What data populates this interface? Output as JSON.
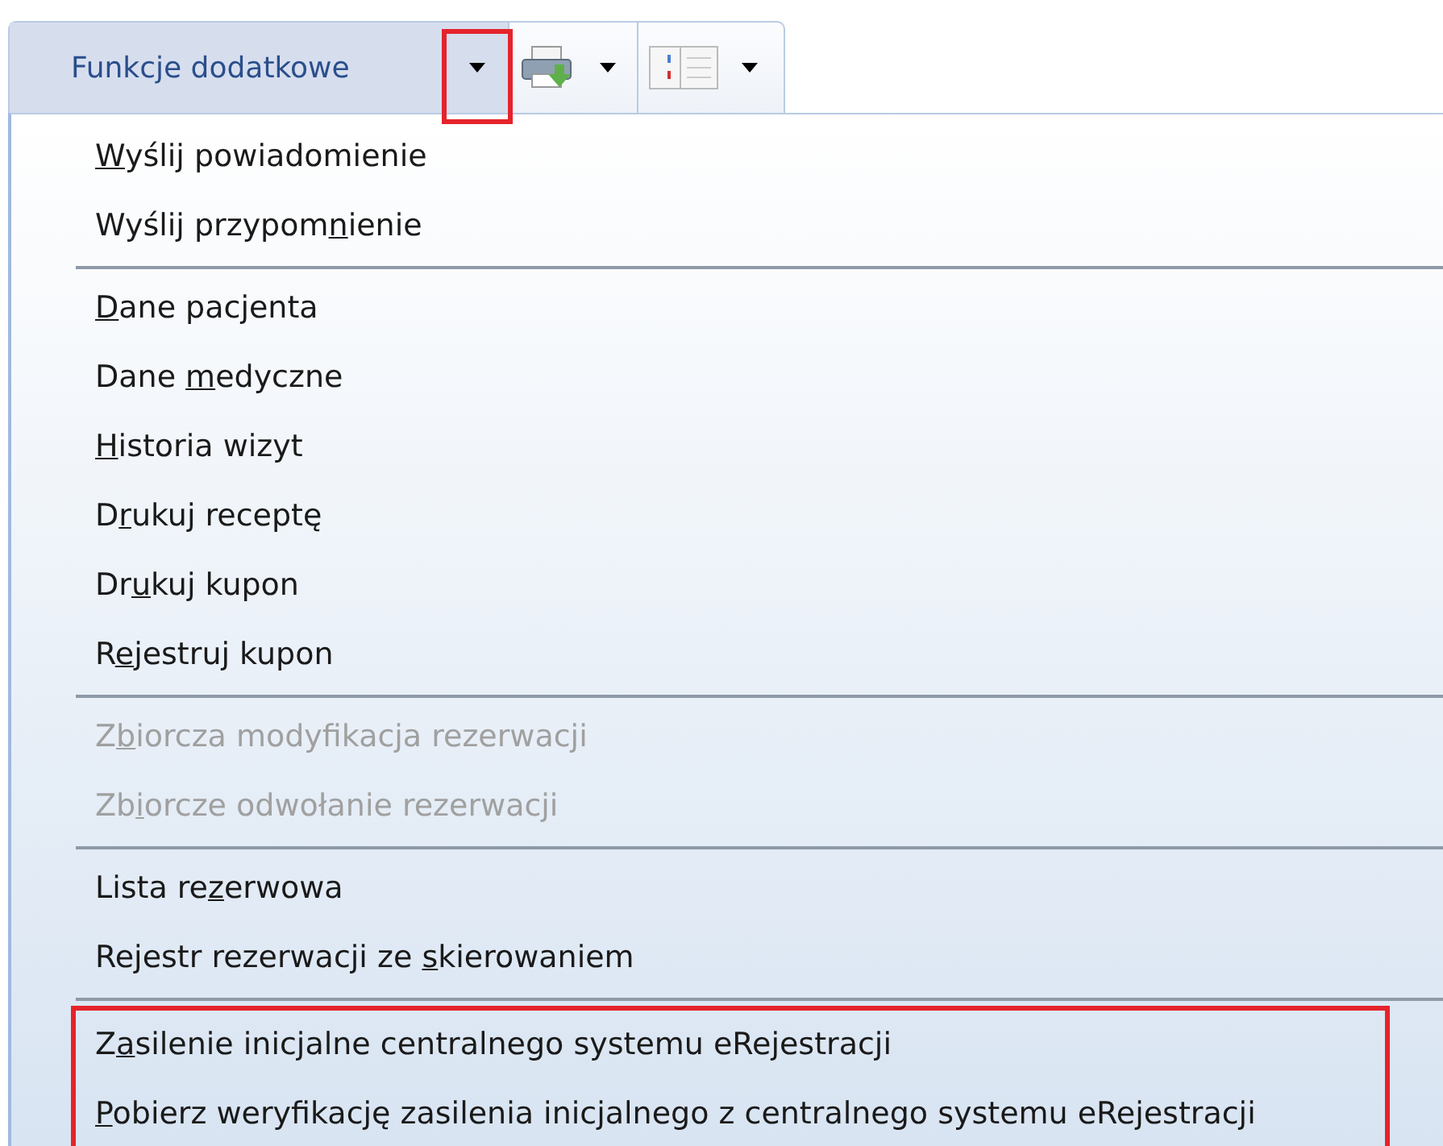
{
  "toolbar": {
    "buttons": [
      {
        "kind": "text",
        "label": "Funkcje dodatkowe",
        "selected": true,
        "annotated": true
      },
      {
        "kind": "printer",
        "selected": false,
        "annotated": false
      },
      {
        "kind": "columns",
        "selected": false,
        "annotated": false
      }
    ]
  },
  "menu": {
    "entries": [
      {
        "kind": "item",
        "key": "W",
        "after": "yślij powiadomienie",
        "disabled": false,
        "annotated": false
      },
      {
        "kind": "item",
        "before": "Wyślij przypom",
        "key": "n",
        "after": "ienie",
        "disabled": false,
        "annotated": false
      },
      {
        "kind": "separator"
      },
      {
        "kind": "item",
        "key": "D",
        "after": "ane pacjenta",
        "disabled": false,
        "annotated": false
      },
      {
        "kind": "item",
        "before": "Dane ",
        "key": "m",
        "after": "edyczne",
        "disabled": false,
        "annotated": false
      },
      {
        "kind": "item",
        "key": "H",
        "after": "istoria wizyt",
        "disabled": false,
        "annotated": false
      },
      {
        "kind": "item",
        "before": "D",
        "key": "r",
        "after": "ukuj receptę",
        "disabled": false,
        "annotated": false
      },
      {
        "kind": "item",
        "before": "Dr",
        "key": "u",
        "after": "kuj kupon",
        "disabled": false,
        "annotated": false
      },
      {
        "kind": "item",
        "before": "R",
        "key": "e",
        "after": "jestruj kupon",
        "disabled": false,
        "annotated": false
      },
      {
        "kind": "separator"
      },
      {
        "kind": "item",
        "before": "Z",
        "key": "b",
        "after": "iorcza modyfikacja rezerwacji",
        "disabled": true,
        "annotated": false
      },
      {
        "kind": "item",
        "before": "Zb",
        "key": "i",
        "after": "orcze odwołanie rezerwacji",
        "disabled": true,
        "annotated": false
      },
      {
        "kind": "separator"
      },
      {
        "kind": "item",
        "before": "Lista re",
        "key": "z",
        "after": "erwowa",
        "disabled": false,
        "annotated": false
      },
      {
        "kind": "item",
        "before": "Rejestr rezerwacji ze ",
        "key": "s",
        "after": "kierowaniem",
        "disabled": false,
        "annotated": false
      },
      {
        "kind": "separator"
      },
      {
        "kind": "item",
        "before": "Z",
        "key": "a",
        "after": "silenie inicjalne centralnego systemu eRejestracji",
        "disabled": false,
        "annotated": true
      },
      {
        "kind": "item",
        "key": "P",
        "after": "obierz weryfikację zasilenia inicjalnego z centralnego systemu eRejestracji",
        "disabled": false,
        "annotated": true
      }
    ]
  }
}
